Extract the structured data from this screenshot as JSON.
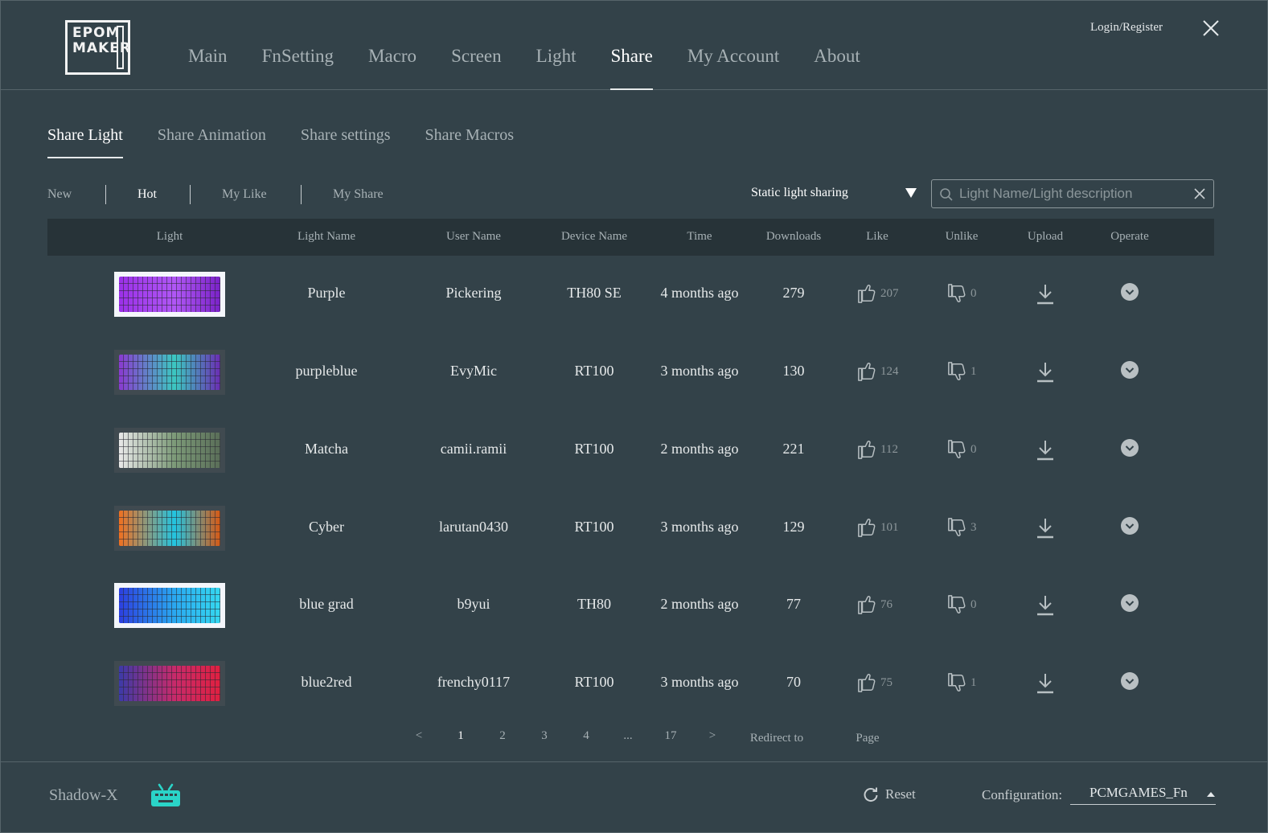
{
  "header": {
    "logo_text": "EPOM MAKER",
    "nav": [
      "Main",
      "FnSetting",
      "Macro",
      "Screen",
      "Light",
      "Share",
      "My Account",
      "About"
    ],
    "active_nav": "Share",
    "login_label": "Login/Register"
  },
  "subtabs": {
    "items": [
      "Share Light",
      "Share Animation",
      "Share settings",
      "Share Macros"
    ],
    "active": "Share Light"
  },
  "filters": {
    "items": [
      "New",
      "Hot",
      "My Like",
      "My Share"
    ],
    "active": "Hot"
  },
  "dropdown": {
    "value": "Static light sharing"
  },
  "search": {
    "placeholder": "Light Name/Light description",
    "value": ""
  },
  "table": {
    "columns": [
      "Light",
      "Light Name",
      "User Name",
      "Device Name",
      "Time",
      "Downloads",
      "Like",
      "Unlike",
      "Upload",
      "Operate"
    ],
    "rows": [
      {
        "light_name": "Purple",
        "user_name": "Pickering",
        "device_name": "TH80 SE",
        "time": "4 months ago",
        "downloads": "279",
        "likes": "207",
        "unlikes": "0",
        "thumb_colors": [
          "#9b30e8",
          "#b057f5",
          "#7a22c8"
        ],
        "thumb_frame": "light"
      },
      {
        "light_name": "purpleblue",
        "user_name": "EvyMic",
        "device_name": "RT100",
        "time": "3 months ago",
        "downloads": "130",
        "likes": "124",
        "unlikes": "1",
        "thumb_colors": [
          "#8a3ad0",
          "#3bc8c0",
          "#6b2db4"
        ],
        "thumb_frame": "dark"
      },
      {
        "light_name": "Matcha",
        "user_name": "camii.ramii",
        "device_name": "RT100",
        "time": "2 months ago",
        "downloads": "221",
        "likes": "112",
        "unlikes": "0",
        "thumb_colors": [
          "#e8e8e8",
          "#7c9a78",
          "#5a6e58"
        ],
        "thumb_frame": "dark"
      },
      {
        "light_name": "Cyber",
        "user_name": "larutan0430",
        "device_name": "RT100",
        "time": "3 months ago",
        "downloads": "129",
        "likes": "101",
        "unlikes": "3",
        "thumb_colors": [
          "#f07020",
          "#22c4e0",
          "#d85a14"
        ],
        "thumb_frame": "dark"
      },
      {
        "light_name": "blue grad",
        "user_name": "b9yui",
        "device_name": "TH80",
        "time": "2 months ago",
        "downloads": "77",
        "likes": "76",
        "unlikes": "0",
        "thumb_colors": [
          "#2c3fe0",
          "#2aa8f0",
          "#35d8f0"
        ],
        "thumb_frame": "light"
      },
      {
        "light_name": "blue2red",
        "user_name": "frenchy0117",
        "device_name": "RT100",
        "time": "3 months ago",
        "downloads": "70",
        "likes": "75",
        "unlikes": "1",
        "thumb_colors": [
          "#3c3aa8",
          "#c82a6a",
          "#e02040"
        ],
        "thumb_frame": "dark"
      }
    ]
  },
  "pagination": {
    "prev": "<",
    "pages": [
      "1",
      "2",
      "3",
      "4",
      "...",
      "17"
    ],
    "next": ">",
    "active": "1",
    "redirect_label": "Redirect to",
    "page_label": "Page"
  },
  "footer": {
    "device_name": "Shadow-X",
    "reset_label": "Reset",
    "config_label": "Configuration:",
    "config_value": "PCMGAMES_Fn"
  },
  "colors": {
    "background": "#334249",
    "table_header": "#273338",
    "accent_keyboard_icon": "#2ad4c8"
  }
}
